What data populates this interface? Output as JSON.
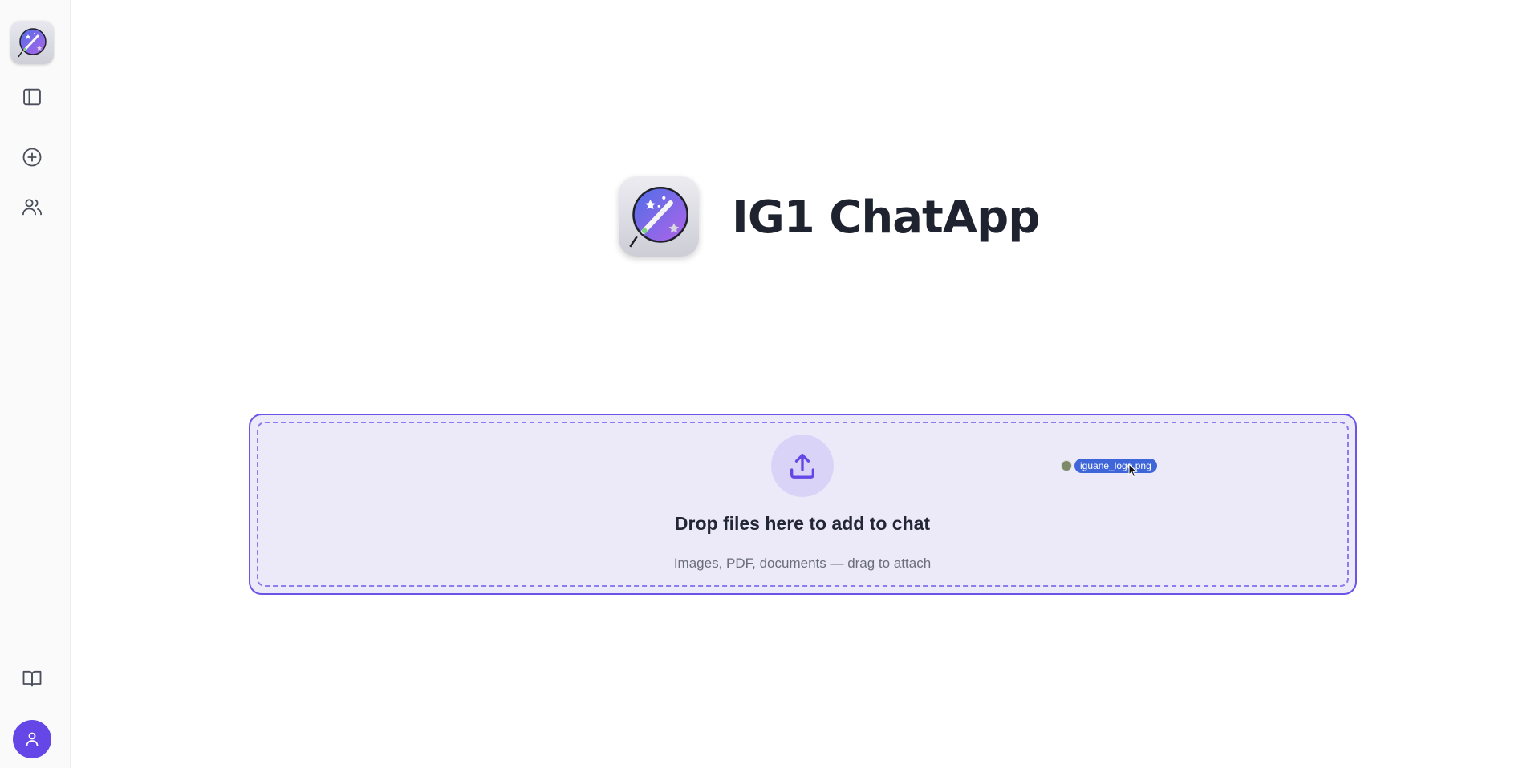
{
  "app": {
    "title": "IG1 ChatApp"
  },
  "sidebar": {
    "items": [
      {
        "name": "app-logo",
        "icon": "magic-wand-logo-icon"
      },
      {
        "name": "toggle-sidebar",
        "icon": "sidebar-panel-icon"
      },
      {
        "name": "new-chat",
        "icon": "plus-circle-icon"
      },
      {
        "name": "users",
        "icon": "users-icon"
      },
      {
        "name": "docs",
        "icon": "book-open-icon"
      },
      {
        "name": "profile",
        "icon": "user-icon"
      }
    ]
  },
  "dropzone": {
    "title": "Drop files here to add to chat",
    "subtitle": "Images, PDF, documents — drag to attach",
    "icon": "upload-icon"
  },
  "dragged_file": {
    "name": "iguane_logo.png"
  },
  "colors": {
    "accent": "#6447e6",
    "dropzone_border": "#6a55e8",
    "dropzone_bg": "#eceaf8",
    "drag_chip": "#3e66d8",
    "title_text": "#1f2330"
  }
}
